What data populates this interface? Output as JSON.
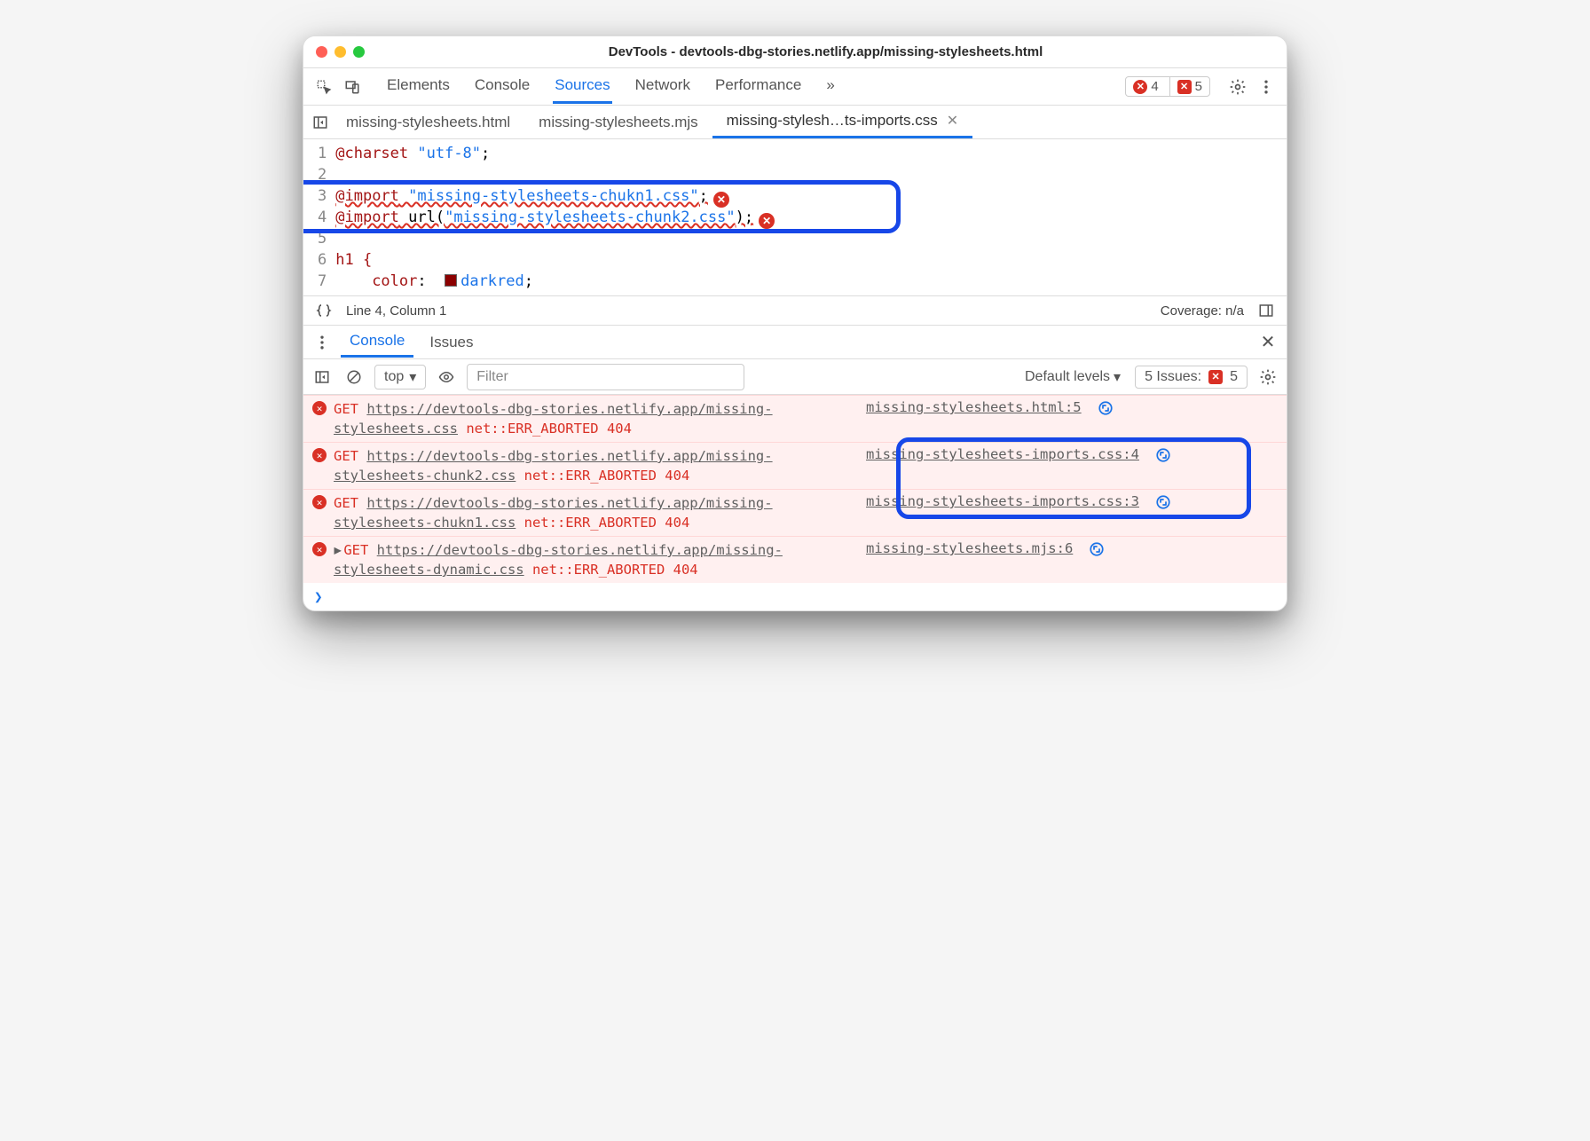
{
  "window": {
    "title": "DevTools - devtools-dbg-stories.netlify.app/missing-stylesheets.html"
  },
  "mainTabs": [
    "Elements",
    "Console",
    "Sources",
    "Network",
    "Performance"
  ],
  "mainActive": 2,
  "badges": {
    "errors": "4",
    "issues": "5"
  },
  "fileTabs": [
    {
      "label": "missing-stylesheets.html",
      "active": false
    },
    {
      "label": "missing-stylesheets.mjs",
      "active": false
    },
    {
      "label": "missing-stylesh…ts-imports.css",
      "active": true
    }
  ],
  "code": {
    "line1_kw": "@charset",
    "line1_str": " \"utf-8\"",
    "line1_end": ";",
    "line3_kw": "@import",
    "line3_str": " \"missing-stylesheets-chukn1.css\"",
    "line3_end": ";",
    "line4_kw": "@import",
    "line4_url": " url(",
    "line4_str": "\"missing-stylesheets-chunk2.css\"",
    "line4_end": ");",
    "line6": "h1 {",
    "line7_prop": "    color",
    "line7_colon": ":  ",
    "line7_val": "darkred",
    "line7_end": ";"
  },
  "status": {
    "pos": "Line 4, Column 1",
    "cov": "Coverage: n/a"
  },
  "drawerTabs": [
    "Console",
    "Issues"
  ],
  "drawerActive": 0,
  "consoleToolbar": {
    "context": "top",
    "filterPlaceholder": "Filter",
    "levels": "Default levels",
    "issuesLabel": "5 Issues:",
    "issuesCount": "5"
  },
  "msgs": [
    {
      "get": "GET ",
      "url": "https://devtools-dbg-stories.netlify.app/missing-stylesheets.css",
      "err": " net::ERR_ABORTED 404",
      "src": "missing-stylesheets.html:5",
      "expand": false
    },
    {
      "get": "GET ",
      "url": "https://devtools-dbg-stories.netlify.app/missing-stylesheets-chunk2.css",
      "err": " net::ERR_ABORTED 404",
      "src": "missing-stylesheets-imports.css:4",
      "expand": false
    },
    {
      "get": "GET ",
      "url": "https://devtools-dbg-stories.netlify.app/missing-stylesheets-chukn1.css",
      "err": " net::ERR_ABORTED 404",
      "src": "missing-stylesheets-imports.css:3",
      "expand": false
    },
    {
      "get": "GET ",
      "url": "https://devtools-dbg-stories.netlify.app/missing-stylesheets-dynamic.css",
      "err": " net::ERR_ABORTED 404",
      "src": "missing-stylesheets.mjs:6",
      "expand": true
    }
  ]
}
